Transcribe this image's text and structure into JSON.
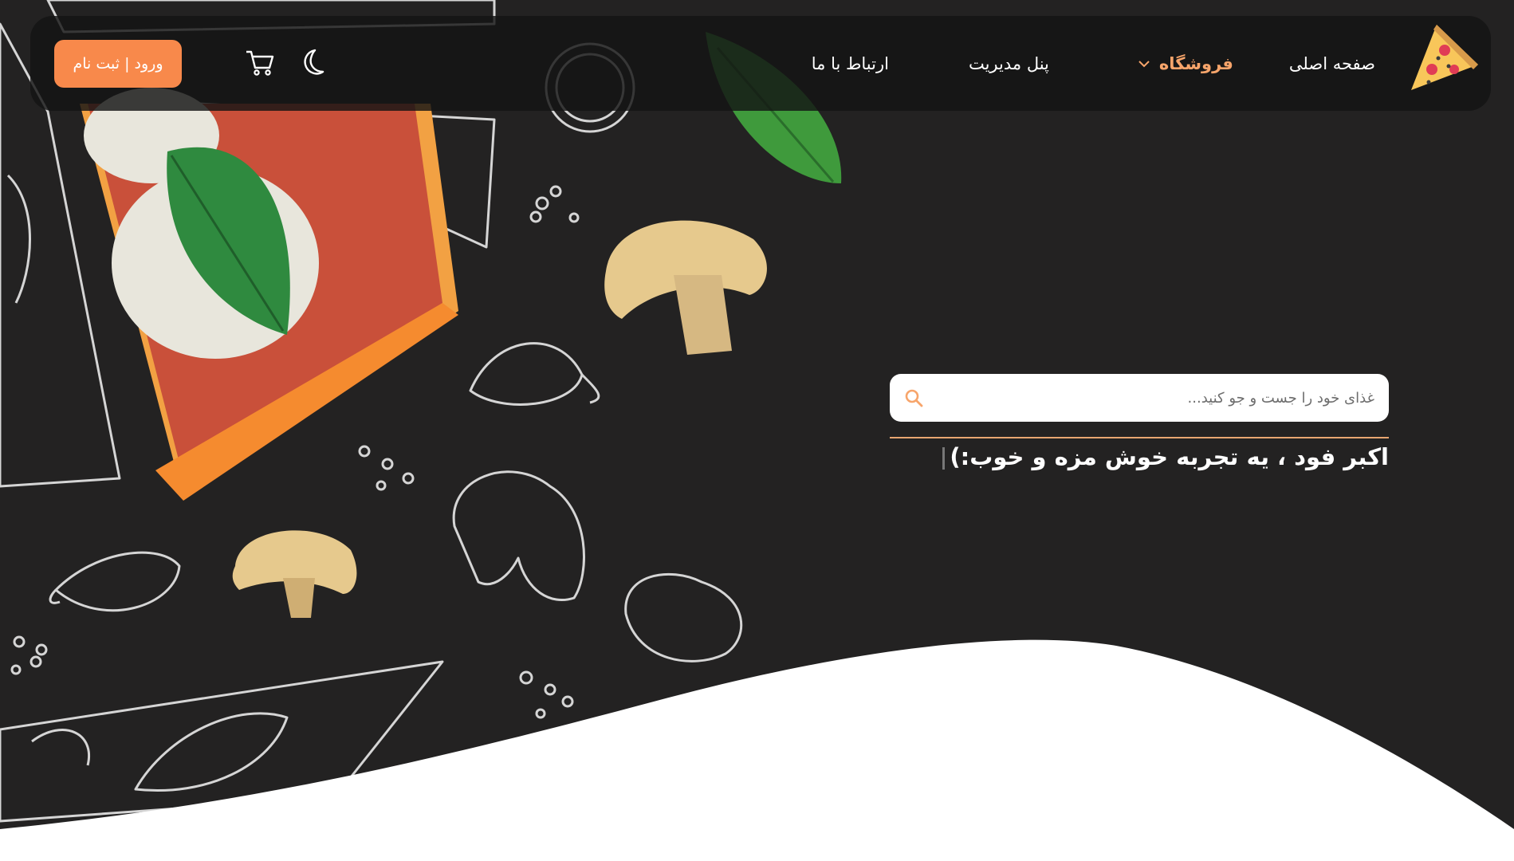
{
  "header": {
    "nav": {
      "home": "صفحه اصلی",
      "shop": "فروشگاه",
      "panel": "پنل مدیریت",
      "contact": "ارتباط با ما"
    },
    "login_label": "ورود | ثبت نام"
  },
  "hero": {
    "search_placeholder": "غذای خود را جست و جو کنید...",
    "tagline": "اکبر فود ، یه تجربه خوش مزه و خوب:)"
  },
  "colors": {
    "accent": "#f8894b",
    "accent_text": "#f7a56b",
    "background": "#232222"
  },
  "icons": [
    "pizza-logo-icon",
    "chevron-down-icon",
    "moon-icon",
    "cart-icon",
    "search-icon"
  ]
}
